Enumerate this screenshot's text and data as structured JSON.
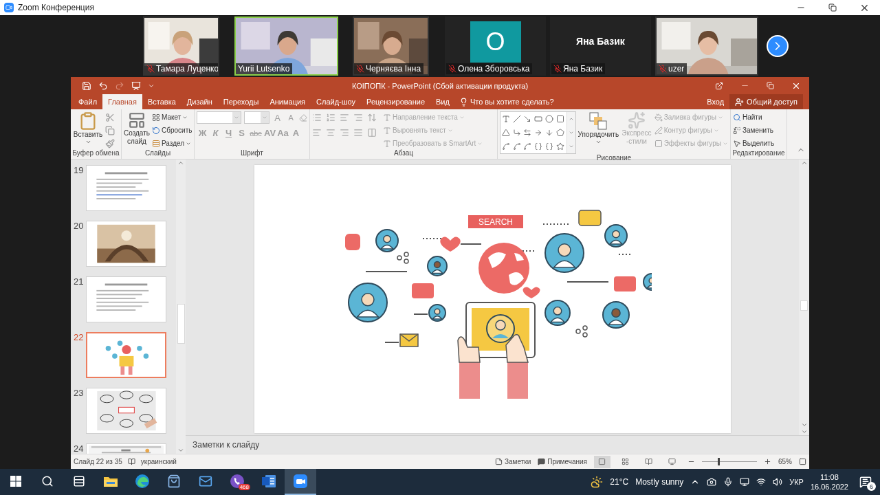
{
  "zoom": {
    "title": "Zoom Конференция"
  },
  "participants": [
    {
      "kind": "video",
      "name": "Тамара Луценко",
      "muted": true,
      "speaking": false
    },
    {
      "kind": "video",
      "name": "Yurii Lutsenko",
      "muted": false,
      "speaking": true
    },
    {
      "kind": "video",
      "name": "Черняєва Інна",
      "muted": true,
      "speaking": false
    },
    {
      "kind": "avatar",
      "initial": "O",
      "name": "Олена Зборовська",
      "muted": true,
      "speaking": false
    },
    {
      "kind": "name",
      "display_name": "Яна Базик",
      "name": "Яна Базик",
      "muted": true,
      "speaking": false
    },
    {
      "kind": "video",
      "name": "uzer",
      "muted": true,
      "speaking": false
    }
  ],
  "powerpoint": {
    "title": "КОІПОПК - PowerPoint (Сбой активации продукта)",
    "tabs": [
      {
        "label": "Файл",
        "selected": false
      },
      {
        "label": "Главная",
        "selected": true
      },
      {
        "label": "Вставка",
        "selected": false
      },
      {
        "label": "Дизайн",
        "selected": false
      },
      {
        "label": "Переходы",
        "selected": false
      },
      {
        "label": "Анимация",
        "selected": false
      },
      {
        "label": "Слайд-шоу",
        "selected": false
      },
      {
        "label": "Рецензирование",
        "selected": false
      },
      {
        "label": "Вид",
        "selected": false
      }
    ],
    "tell_me": "Что вы хотите сделать?",
    "sign_in": "Вход",
    "share": "Общий доступ",
    "ribbon": {
      "clipboard": {
        "label": "Буфер обмена",
        "paste": "Вставить"
      },
      "slides": {
        "label": "Слайды",
        "new_slide": "Создать слайд",
        "layout": "Макет",
        "reset": "Сбросить",
        "section": "Раздел"
      },
      "font": {
        "label": "Шрифт",
        "grow": "A",
        "shrink": "A",
        "formats": [
          {
            "label": "Ж",
            "disabled": true
          },
          {
            "label": "К",
            "disabled": true
          },
          {
            "label": "Ч",
            "disabled": true
          },
          {
            "label": "S",
            "disabled": true
          },
          {
            "label": "abc",
            "disabled": true
          },
          {
            "label": "AV",
            "disabled": true
          },
          {
            "label": "Aa",
            "disabled": true
          },
          {
            "label": "A",
            "disabled": true
          }
        ]
      },
      "paragraph": {
        "label": "Абзац",
        "commands": [
          {
            "label": "Направление текста",
            "disabled": true
          },
          {
            "label": "Выровнять текст",
            "disabled": true
          },
          {
            "label": "Преобразовать в SmartArt",
            "disabled": true
          }
        ]
      },
      "drawing": {
        "label": "Рисование",
        "arrange": "Упорядочить",
        "quick_styles": "Экспресс-стили",
        "quick_styles_disabled": true,
        "commands": [
          {
            "label": "Заливка фигуры",
            "disabled": true
          },
          {
            "label": "Контур фигуры",
            "disabled": true
          },
          {
            "label": "Эффекты фигуры",
            "disabled": true
          }
        ]
      },
      "editing": {
        "label": "Редактирование",
        "commands": [
          "Найти",
          "Заменить",
          "Выделить"
        ]
      }
    },
    "thumbnails": [
      {
        "number": "19",
        "selected": false,
        "kind": "picture"
      },
      {
        "number": "20",
        "selected": false,
        "kind": "picture"
      },
      {
        "number": "21",
        "selected": false,
        "kind": "picture"
      },
      {
        "number": "22",
        "selected": true,
        "kind": "picture"
      },
      {
        "number": "23",
        "selected": false,
        "kind": "picture"
      },
      {
        "number": "24",
        "selected": false,
        "kind": "picture"
      }
    ],
    "slide": {
      "search_label": "SEARCH"
    },
    "notes_placeholder": "Заметки к слайду",
    "status": {
      "slide_counter": "Слайд 22 из 35",
      "language": "украинский",
      "notes": "Заметки",
      "comments": "Примечания",
      "zoom_slider": {
        "level": 0.3
      },
      "zoom": "65%"
    }
  },
  "taskbar": {
    "apps": [
      {
        "kind": "explorer",
        "selected": false
      },
      {
        "kind": "edge",
        "selected": false
      },
      {
        "kind": "store",
        "selected": false
      },
      {
        "kind": "mail",
        "selected": false
      },
      {
        "kind": "viber",
        "selected": false,
        "badge": "468"
      },
      {
        "kind": "word",
        "selected": false
      },
      {
        "kind": "zoom",
        "selected": true
      }
    ],
    "weather": {
      "temperature": "21°C",
      "condition": "Mostly sunny"
    },
    "language": "УКР",
    "time": "11:08",
    "date": "16.06.2022",
    "notifications": "6"
  }
}
